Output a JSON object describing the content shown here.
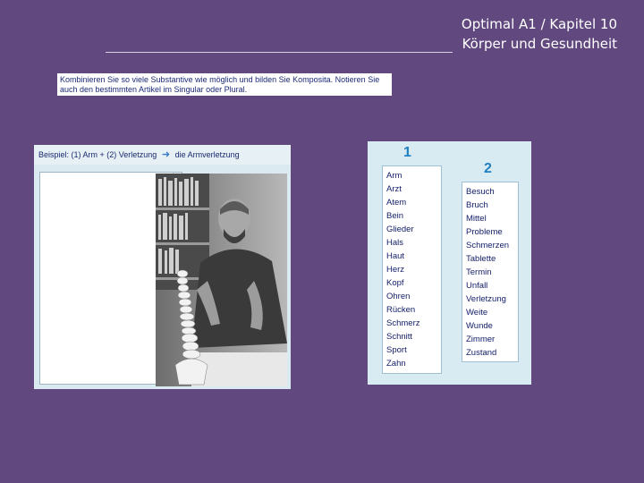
{
  "header": {
    "title_line1": "Optimal A1 / Kapitel 10",
    "title_line2": "Körper und Gesundheit"
  },
  "instruction": {
    "text": "Kombinieren Sie so viele Substantive wie möglich und bilden Sie Komposita. Notieren Sie auch den bestimmten Artikel im Singular oder Plural."
  },
  "example": {
    "prefix": "Beispiel: (1) Arm + (2) Verletzung",
    "arrow": "➜",
    "result": "die Armverletzung"
  },
  "columns": [
    {
      "number": "1",
      "words": [
        "Arm",
        "Arzt",
        "Atem",
        "Bein",
        "Glieder",
        "Hals",
        "Haut",
        "Herz",
        "Kopf",
        "Ohren",
        "Rücken",
        "Schmerz",
        "Schnitt",
        "Sport",
        "Zahn"
      ]
    },
    {
      "number": "2",
      "words": [
        "Besuch",
        "Bruch",
        "Mittel",
        "Probleme",
        "Schmerzen",
        "Tablette",
        "Termin",
        "Unfall",
        "Verletzung",
        "Weite",
        "Wunde",
        "Zimmer",
        "Zustand"
      ]
    }
  ],
  "colors": {
    "background": "#61497f",
    "accent_number": "#2080c0",
    "text_dark_blue": "#15206a"
  }
}
